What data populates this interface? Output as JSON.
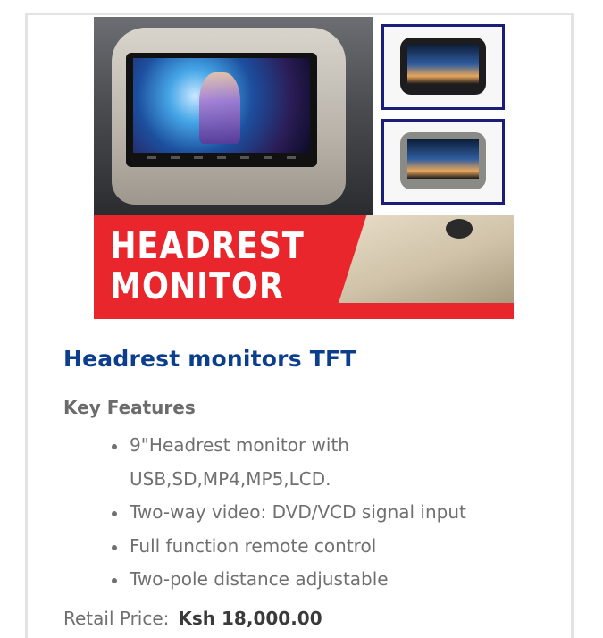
{
  "product_image": {
    "banner_lines": [
      "HEADREST",
      "MONITOR"
    ],
    "colors": {
      "banner_red": "#e8262c",
      "thumb_border": "#1b1d7a"
    }
  },
  "product": {
    "title": "Headrest monitors TFT",
    "features_heading": "Key Features",
    "features": [
      "9\"Headrest monitor with USB,SD,MP4,MP5,LCD.",
      "Two-way video: DVD/VCD signal input",
      "Full function remote control",
      "Two-pole distance adjustable"
    ],
    "price_label": "Retail Price:",
    "price_value": "Ksh 18,000.00"
  },
  "colors": {
    "title": "#0c3e8e",
    "text": "#707070"
  }
}
